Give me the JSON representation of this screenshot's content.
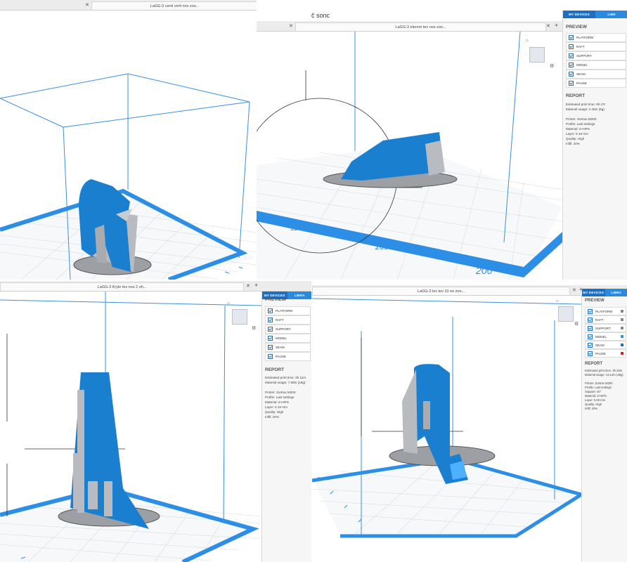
{
  "panels": {
    "top_left": {
      "tab_title": "LaGG-3 cenk verli nos zoo..."
    },
    "top_right": {
      "top_text": "ĉ sonc",
      "tab_title": "LaGG-3 elerom tev nos zoo...",
      "side": {
        "tab_my_devices": "MY DEVICES",
        "tab_library": "LIBR",
        "preview_title": "PREVIEW",
        "items": [
          "PLATFORM",
          "RAFT",
          "SUPPORT",
          "MODEL",
          "SEAM",
          "PAUSE"
        ],
        "report_title": "REPORT",
        "report_lines": [
          "Estimated print time: 9h 47r",
          "Material usage: 2.46m (6g)",
          "",
          "Printer: Zortrax M200",
          "Profile: Last settings",
          "Material: Z-HIPS",
          "Layer: 0.19 mm",
          "Quality: High",
          "Infill: 20%"
        ]
      },
      "axis_labels": [
        "120",
        "160",
        "200"
      ]
    },
    "bottom_left": {
      "tab_title": "LaGG-3 Kryle tev nos 2 oh...",
      "side": {
        "tab_my_devices": "MY DEVICES",
        "tab_library": "LIBRA",
        "preview_title": "PREVIEW",
        "items": [
          "PLATFORM",
          "RAFT",
          "SUPPORT",
          "MODEL",
          "SEAM",
          "PAUSE"
        ],
        "report_title": "REPORT",
        "report_lines": [
          "Estimated print time: 3h 11m",
          "Material usage: 7.58m (19g)",
          "",
          "Printer: Zortrax M200",
          "Profile: Last settings",
          "Material: Z-HIPS",
          "Layer: 0.19 mm",
          "Quality: High",
          "Infill: 20%"
        ]
      }
    },
    "bottom_right": {
      "tab_title": "LaGG-3 los tev 10 ee zoo...",
      "side": {
        "tab_my_devices": "MY DEVICES",
        "tab_library": "LIBRA",
        "preview_title": "PREVIEW",
        "items": [
          "PLATFORM",
          "RAFT",
          "SUPPORT",
          "MODEL",
          "SEAM",
          "PAUSE"
        ],
        "swatches": [
          "#888888",
          "#888888",
          "#888888",
          "#3a8fe0",
          "#1e6fc0",
          "#d22222"
        ],
        "report_title": "REPORT",
        "report_lines": [
          "Estimated print time: 3h 26m",
          "Material usage: 13.14m (38g)",
          "",
          "Printer: Zortrax M200",
          "Profile: Last settings",
          "Support: 40°",
          "Material: Z-HIPS",
          "Layer: 0.29 mm",
          "Quality: High",
          "Infill: 20%"
        ]
      }
    }
  },
  "colors": {
    "model_blue": "#1b7fd0",
    "support_gray": "#b8bcc0",
    "platform_edge": "#2d8ee6",
    "grid": "#d7dce2"
  }
}
